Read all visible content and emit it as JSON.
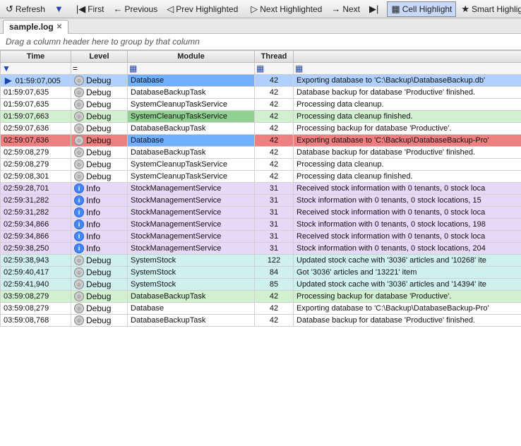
{
  "toolbar": {
    "buttons": [
      {
        "name": "refresh-button",
        "icon": "↺",
        "label": "Refresh"
      },
      {
        "name": "filter-button",
        "icon": "▼",
        "label": "",
        "icon_type": "funnel"
      },
      {
        "name": "first-button",
        "icon": "◀|",
        "label": "First"
      },
      {
        "name": "previous-button",
        "icon": "←",
        "label": "Previous"
      },
      {
        "name": "prev-highlighted-button",
        "icon": "◁",
        "label": "Prev Highlighted"
      },
      {
        "name": "next-highlighted-button",
        "icon": "▷",
        "label": "Next Highlighted"
      },
      {
        "name": "next-button",
        "icon": "→",
        "label": "Next"
      },
      {
        "name": "last-button",
        "icon": "|▶",
        "label": ""
      },
      {
        "name": "cell-highlight-button",
        "icon": "▦",
        "label": "Cell Highlight",
        "active": true
      },
      {
        "name": "smart-highlight-button",
        "icon": "★",
        "label": "Smart Highlight"
      },
      {
        "name": "extra-button",
        "icon": "⊞",
        "label": ""
      }
    ]
  },
  "tabs": [
    {
      "name": "sample-log-tab",
      "label": "sample.log",
      "active": true
    }
  ],
  "group_area": {
    "text": "Drag a column header here to group by that column"
  },
  "table": {
    "columns": [
      {
        "key": "time",
        "label": "Time"
      },
      {
        "key": "level",
        "label": "Level"
      },
      {
        "key": "module",
        "label": "Module"
      },
      {
        "key": "thread",
        "label": "Thread"
      },
      {
        "key": "msg",
        "label": ""
      }
    ],
    "filter_row": {
      "time_icon": "▼",
      "level_eq": "=",
      "module_filter": "▦",
      "thread_filter": "▦",
      "msg_filter": "▦"
    },
    "rows": [
      {
        "time": "01:59:07,005",
        "level": "Debug",
        "level_icon": "debug",
        "module": "Database",
        "thread": "42",
        "msg": "Exporting database to 'C:\\Backup\\DatabaseBackup.db'",
        "row_class": "row-blue-hl",
        "module_class": "cell-blue",
        "arrow": true
      },
      {
        "time": "01:59:07,635",
        "level": "Debug",
        "level_icon": "debug",
        "module": "DatabaseBackupTask",
        "thread": "42",
        "msg": "Database backup for database 'Productive' finished.",
        "row_class": "row-white"
      },
      {
        "time": "01:59:07,635",
        "level": "Debug",
        "level_icon": "debug",
        "module": "SystemCleanupTaskService",
        "thread": "42",
        "msg": "Processing data cleanup.",
        "row_class": "row-white"
      },
      {
        "time": "01:59:07,663",
        "level": "Debug",
        "level_icon": "debug",
        "module": "SystemCleanupTaskService",
        "thread": "42",
        "msg": "Processing data cleanup finished.",
        "row_class": "row-green2",
        "module_class": "cell-green"
      },
      {
        "time": "02:59:07,636",
        "level": "Debug",
        "level_icon": "debug",
        "module": "DatabaseBackupTask",
        "thread": "42",
        "msg": "Processing backup for database 'Productive'.",
        "row_class": "row-white"
      },
      {
        "time": "02:59:07,636",
        "level": "Debug",
        "level_icon": "debug",
        "module": "Database",
        "thread": "42",
        "msg": "Exporting database to 'C:\\Backup\\DatabaseBackup-Pro'",
        "row_class": "row-red",
        "module_class": "cell-blue"
      },
      {
        "time": "02:59:08,279",
        "level": "Debug",
        "level_icon": "debug",
        "module": "DatabaseBackupTask",
        "thread": "42",
        "msg": "Database backup for database 'Productive' finished.",
        "row_class": "row-white"
      },
      {
        "time": "02:59:08,279",
        "level": "Debug",
        "level_icon": "debug",
        "module": "SystemCleanupTaskService",
        "thread": "42",
        "msg": "Processing data cleanup.",
        "row_class": "row-white"
      },
      {
        "time": "02:59:08,301",
        "level": "Debug",
        "level_icon": "debug",
        "module": "SystemCleanupTaskService",
        "thread": "42",
        "msg": "Processing data cleanup finished.",
        "row_class": "row-white"
      },
      {
        "time": "02:59:28,701",
        "level": "Info",
        "level_icon": "info",
        "module": "StockManagementService",
        "thread": "31",
        "msg": "Received stock information with 0 tenants, 0 stock loca",
        "row_class": "row-purple"
      },
      {
        "time": "02:59:31,282",
        "level": "Info",
        "level_icon": "info",
        "module": "StockManagementService",
        "thread": "31",
        "msg": "Stock information with 0 tenants, 0 stock locations, 15",
        "row_class": "row-purple"
      },
      {
        "time": "02:59:31,282",
        "level": "Info",
        "level_icon": "info",
        "module": "StockManagementService",
        "thread": "31",
        "msg": "Received stock information with 0 tenants, 0 stock loca",
        "row_class": "row-purple"
      },
      {
        "time": "02:59:34,866",
        "level": "Info",
        "level_icon": "info",
        "module": "StockManagementService",
        "thread": "31",
        "msg": "Stock information with 0 tenants, 0 stock locations, 198",
        "row_class": "row-purple"
      },
      {
        "time": "02:59:34,866",
        "level": "Info",
        "level_icon": "info",
        "module": "StockManagementService",
        "thread": "31",
        "msg": "Received stock information with 0 tenants, 0 stock loca",
        "row_class": "row-purple"
      },
      {
        "time": "02:59:38,250",
        "level": "Info",
        "level_icon": "info",
        "module": "StockManagementService",
        "thread": "31",
        "msg": "Stock information with 0 tenants, 0 stock locations, 204",
        "row_class": "row-purple"
      },
      {
        "time": "02:59:38,943",
        "level": "Debug",
        "level_icon": "debug",
        "module": "SystemStock",
        "thread": "122",
        "msg": "Updated stock cache with '3036' articles and '10268' ite",
        "row_class": "row-teal"
      },
      {
        "time": "02:59:40,417",
        "level": "Debug",
        "level_icon": "debug",
        "module": "SystemStock",
        "thread": "84",
        "msg": "Got '3036' articles and '13221' item",
        "row_class": "row-teal"
      },
      {
        "time": "02:59:41,940",
        "level": "Debug",
        "level_icon": "debug",
        "module": "SystemStock",
        "thread": "85",
        "msg": "Updated stock cache with '3036' articles and '14394' ite",
        "row_class": "row-teal"
      },
      {
        "time": "03:59:08,279",
        "level": "Debug",
        "level_icon": "debug",
        "module": "DatabaseBackupTask",
        "thread": "42",
        "msg": "Processing backup for database 'Productive'.",
        "row_class": "row-green2"
      },
      {
        "time": "03:59:08,279",
        "level": "Debug",
        "level_icon": "debug",
        "module": "Database",
        "thread": "42",
        "msg": "Exporting database to 'C:\\Backup\\DatabaseBackup-Pro'",
        "row_class": "row-white"
      },
      {
        "time": "03:59:08,768",
        "level": "Debug",
        "level_icon": "debug",
        "module": "DatabaseBackupTask",
        "thread": "42",
        "msg": "Database backup for database 'Productive' finished.",
        "row_class": "row-white"
      }
    ]
  }
}
